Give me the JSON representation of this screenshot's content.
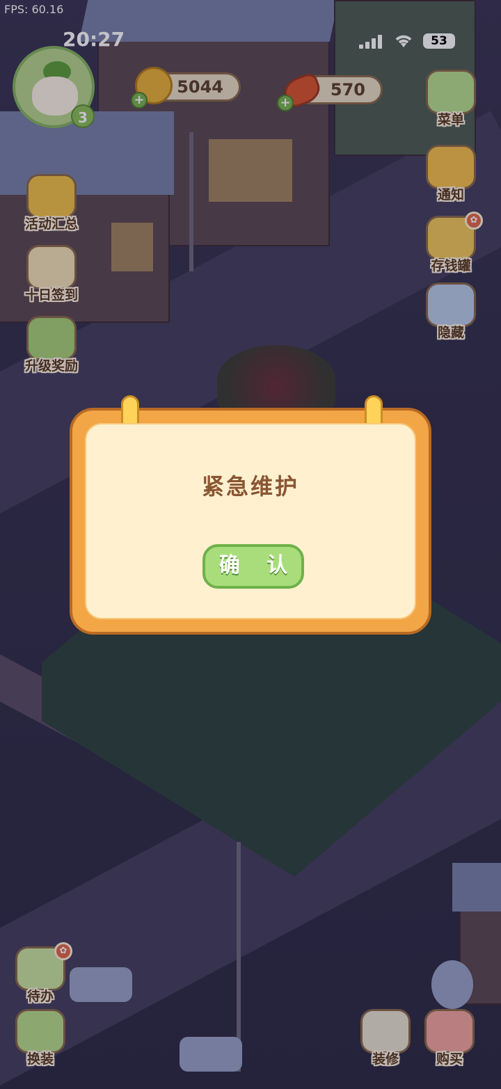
{
  "fps_label": "FPS: 60.16",
  "status": {
    "time": "20:27",
    "battery": "53"
  },
  "player": {
    "level": "3"
  },
  "currencies": {
    "coins": "5044",
    "carrots": "570"
  },
  "left_menu": [
    {
      "label": "活动汇总",
      "icon": "crown-icon"
    },
    {
      "label": "十日签到",
      "icon": "calendar-icon"
    },
    {
      "label": "升级奖励",
      "icon": "upgrade-icon"
    }
  ],
  "right_menu": [
    {
      "label": "菜单",
      "icon": "menu-list-icon"
    },
    {
      "label": "通知",
      "icon": "bell-icon"
    },
    {
      "label": "存钱罐",
      "icon": "piggy-bank-icon"
    },
    {
      "label": "隐藏",
      "icon": "hide-icon"
    }
  ],
  "bottom_left": [
    {
      "label": "待办",
      "icon": "todo-icon"
    },
    {
      "label": "换装",
      "icon": "dress-up-icon"
    }
  ],
  "bottom_right": [
    {
      "label": "装修",
      "icon": "decorate-icon"
    },
    {
      "label": "购买",
      "icon": "shop-icon"
    }
  ],
  "dialog": {
    "title": "紧急维护",
    "confirm_label": "确 认"
  }
}
